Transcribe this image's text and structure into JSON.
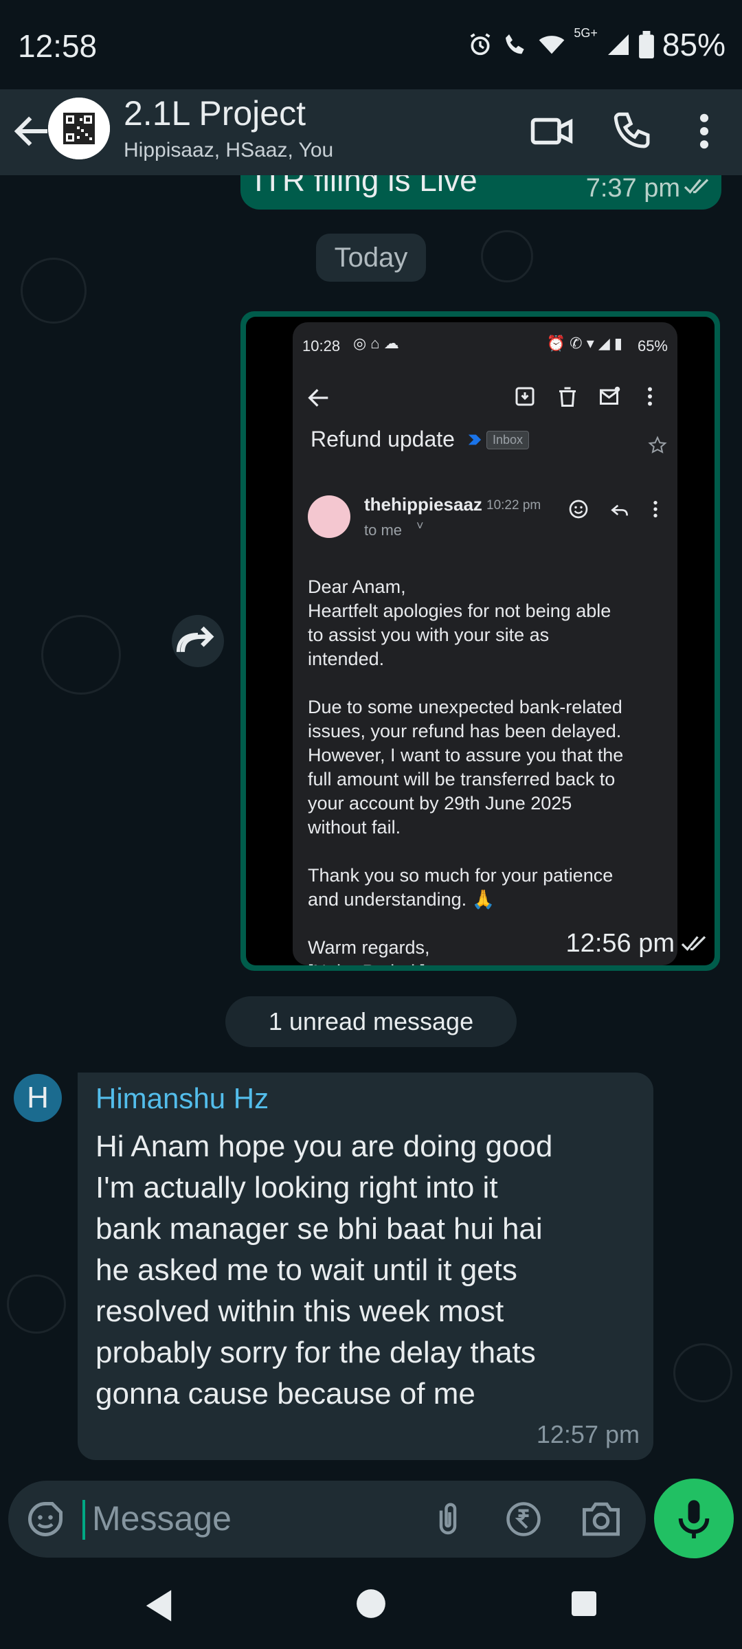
{
  "status_bar": {
    "time": "12:58",
    "network": "5G+",
    "battery": "85%"
  },
  "header": {
    "title": "2.1L Project",
    "members": "Hippisaaz, HSaaz, You",
    "icons": [
      "back-arrow-icon",
      "video-call-icon",
      "phone-icon",
      "more-vert-icon"
    ]
  },
  "chat": {
    "previous_message": {
      "text": "ITR filing is Live",
      "time": "7:37 pm"
    },
    "date_divider": "Today",
    "image_message": {
      "time": "12:56 pm",
      "screenshot": {
        "status_time": "10:28",
        "status_battery": "65%",
        "subject": "Refund update",
        "label": "Inbox",
        "sender": "thehippiesaaz",
        "sent_time": "10:22 pm",
        "recipient": "to me",
        "body": [
          "Dear Anam,",
          "Heartfelt apologies for not being able",
          "to assist you with your site as",
          "intended.",
          "",
          "Due to some unexpected bank-related",
          "issues, your refund has been delayed.",
          "However, I want to assure you that the",
          "full amount will be transferred back to",
          "your account by 29th June 2025",
          "without fail.",
          "",
          "Thank you so much for your patience",
          "and understanding. 🙏",
          "",
          "Warm regards,",
          "[Neha Pathak]"
        ]
      }
    },
    "unread_divider": "1 unread message",
    "incoming_message": {
      "avatar_letter": "H",
      "sender": "Himanshu Hz",
      "text": "Hi Anam hope you are doing good\nI'm actually looking right into it\nbank manager se bhi baat hui hai\nhe asked me to wait until it gets\nresolved within this week most\nprobably sorry for the delay thats\ngonna cause because of me",
      "time": "12:57 pm"
    }
  },
  "composer": {
    "placeholder": "Message"
  },
  "colors": {
    "background": "#0b141a",
    "header": "#1f2c33",
    "outgoing_bubble": "#005c4b",
    "incoming_bubble": "#1f2c33",
    "accent_green": "#21c063",
    "sender_name": "#53bdeb"
  }
}
